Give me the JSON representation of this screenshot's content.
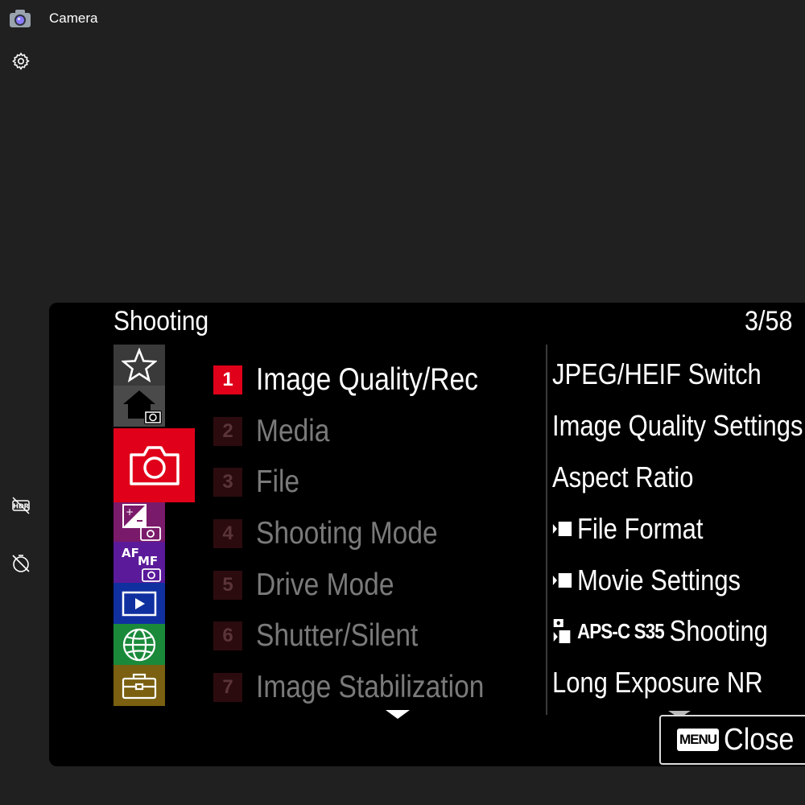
{
  "app": {
    "title": "Camera"
  },
  "camera_menu": {
    "title": "Shooting",
    "page": "3/58",
    "tabs": [
      {
        "name": "favorites",
        "color": "#3a3a3a"
      },
      {
        "name": "main",
        "color": "#4a4a4a"
      },
      {
        "name": "shooting",
        "color": "#e0001a"
      },
      {
        "name": "exposure",
        "color": "#7a1a6a"
      },
      {
        "name": "focus",
        "color": "#5a1a9a"
      },
      {
        "name": "playback",
        "color": "#1030a0"
      },
      {
        "name": "network",
        "color": "#1a8a3a"
      },
      {
        "name": "setup",
        "color": "#7a6010"
      }
    ],
    "items": [
      {
        "num": "1",
        "label": "Image Quality/Rec",
        "active": true
      },
      {
        "num": "2",
        "label": "Media"
      },
      {
        "num": "3",
        "label": "File"
      },
      {
        "num": "4",
        "label": "Shooting Mode"
      },
      {
        "num": "5",
        "label": "Drive Mode"
      },
      {
        "num": "6",
        "label": "Shutter/Silent"
      },
      {
        "num": "7",
        "label": "Image Stabilization"
      }
    ],
    "sub_items": [
      {
        "label": "JPEG/HEIF Switch"
      },
      {
        "label": "Image Quality Settings"
      },
      {
        "label": "Aspect Ratio"
      },
      {
        "label": "File Format",
        "icon": "movie-icon"
      },
      {
        "label": "Movie Settings",
        "icon": "movie-icon"
      },
      {
        "label": "Shooting",
        "icon": "aps-c-icon",
        "prefix": "APS-C S35"
      },
      {
        "label": "Long Exposure NR"
      }
    ],
    "menu_badge": "MENU",
    "close_label": "Close"
  }
}
